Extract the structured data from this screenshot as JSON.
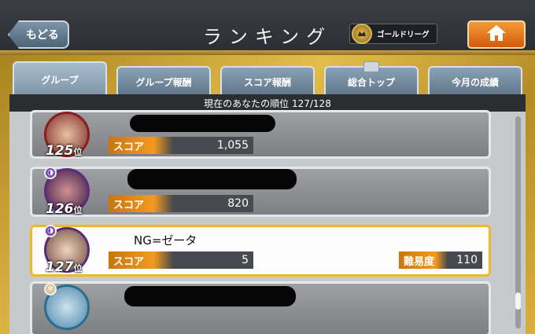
{
  "header": {
    "back_label": "もどる",
    "title": "ランキング",
    "league_label": "ゴールドリーグ",
    "icons": {
      "back": "chevron-left-icon",
      "home": "home-icon",
      "league": "gold-league-emblem-icon"
    }
  },
  "tabs": [
    {
      "label": "グループ",
      "active": true
    },
    {
      "label": "グループ報酬",
      "active": false
    },
    {
      "label": "スコア報酬",
      "active": false
    },
    {
      "label": "総合トップ",
      "active": false
    },
    {
      "label": "今月の成績",
      "active": false
    }
  ],
  "rank_header": "現在のあなたの順位 127/128",
  "score_label": "スコア",
  "difficulty_label": "難易度",
  "rank_suffix": "位",
  "rows": [
    {
      "rank": "125",
      "name": "",
      "score": "1,055",
      "mine": false
    },
    {
      "rank": "126",
      "name": "",
      "score": "820",
      "mine": false
    },
    {
      "rank": "127",
      "name": "NG=ゼータ",
      "score": "5",
      "difficulty": "110",
      "mine": true
    },
    {
      "rank": "",
      "name": "",
      "score": "",
      "mine": false
    }
  ],
  "colors": {
    "accent_orange": "#f29a1f",
    "gold": "#e2bd4a",
    "highlight_border": "#f0b72c"
  }
}
